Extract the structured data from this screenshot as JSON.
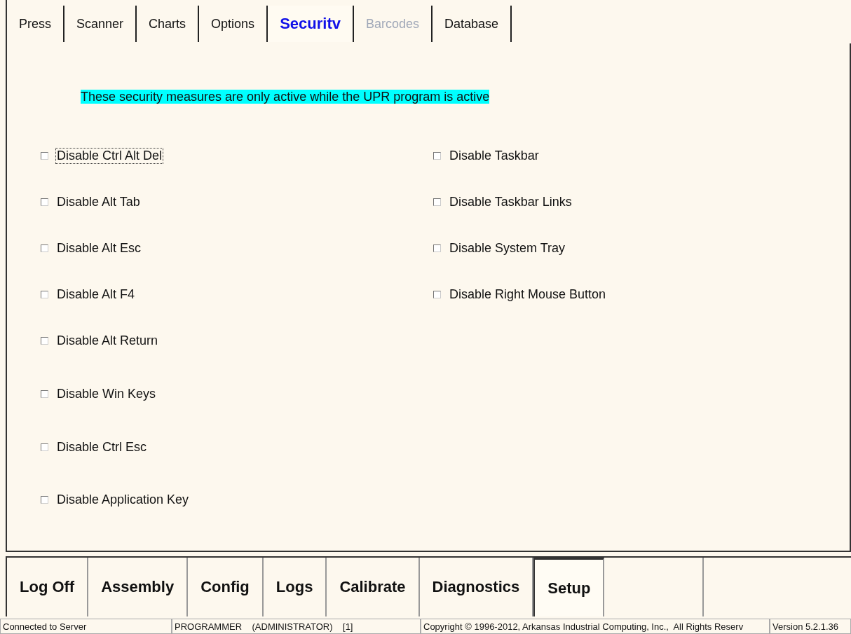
{
  "tabs": [
    {
      "label": "Press",
      "selected": false,
      "disabled": false
    },
    {
      "label": "Scanner",
      "selected": false,
      "disabled": false
    },
    {
      "label": "Charts",
      "selected": false,
      "disabled": false
    },
    {
      "label": "Options",
      "selected": false,
      "disabled": false
    },
    {
      "label": "Securitv",
      "selected": true,
      "disabled": false
    },
    {
      "label": "Barcodes",
      "selected": false,
      "disabled": true
    },
    {
      "label": "Database",
      "selected": false,
      "disabled": false
    }
  ],
  "notice": "These security measures are only active while the UPR program is active",
  "left_options": [
    {
      "label": "Disable Ctrl Alt Del",
      "checked": false,
      "focused": true
    },
    {
      "label": "Disable Alt Tab",
      "checked": false,
      "focused": false
    },
    {
      "label": "Disable Alt Esc",
      "checked": false,
      "focused": false
    },
    {
      "label": "Disable Alt F4",
      "checked": false,
      "focused": false
    },
    {
      "label": "Disable Alt Return",
      "checked": false,
      "focused": false
    },
    {
      "label": "Disable Win Keys",
      "checked": false,
      "focused": false
    },
    {
      "label": "Disable Ctrl Esc",
      "checked": false,
      "focused": false
    },
    {
      "label": "Disable Application Key",
      "checked": false,
      "focused": false
    }
  ],
  "right_options": [
    {
      "label": "Disable Taskbar",
      "checked": false,
      "focused": false
    },
    {
      "label": "Disable Taskbar Links",
      "checked": false,
      "focused": false
    },
    {
      "label": "Disable System Tray",
      "checked": false,
      "focused": false
    },
    {
      "label": "Disable Right Mouse Button",
      "checked": false,
      "focused": false
    }
  ],
  "nav_buttons": [
    {
      "label": "Log Off",
      "selected": false
    },
    {
      "label": "Assembly",
      "selected": false
    },
    {
      "label": "Config",
      "selected": false
    },
    {
      "label": "Logs",
      "selected": false
    },
    {
      "label": "Calibrate",
      "selected": false
    },
    {
      "label": "Diagnostics",
      "selected": false
    },
    {
      "label": "Setup",
      "selected": true
    }
  ],
  "status_bar": [
    "Connected to Server",
    "PROGRAMMER    (ADMINISTRATOR)    [1]",
    "Copyright © 1996-2012, Arkansas Industrial Computing, Inc.,  All Rights Reserv",
    "Version 5.2.1.36"
  ]
}
